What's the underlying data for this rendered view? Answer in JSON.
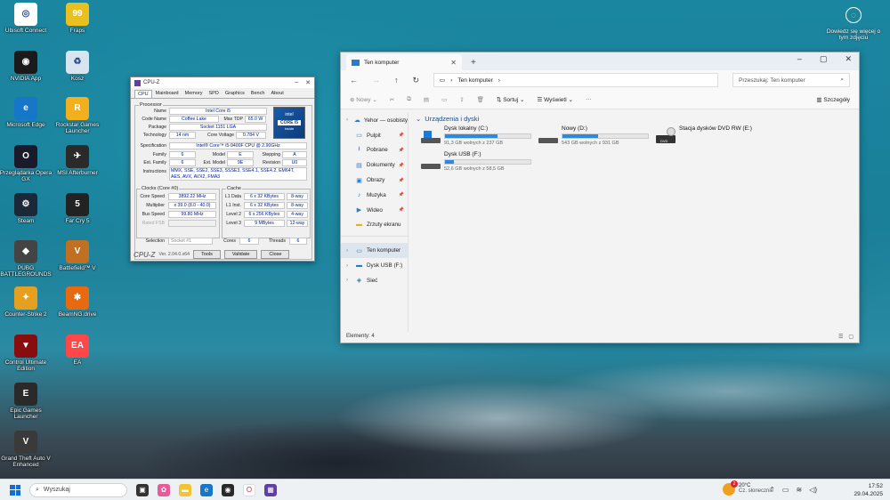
{
  "desktop": {
    "left_col": [
      {
        "label": "Ubisoft Connect",
        "icon": "ubisoft-icon",
        "color": "#ffffff",
        "glyph": "◎"
      },
      {
        "label": "NVIDIA App",
        "icon": "nvidia-icon",
        "color": "#1a1a1a",
        "glyph": "◉"
      },
      {
        "label": "Microsoft Edge",
        "icon": "edge-icon",
        "color": "#1677c8",
        "glyph": "e"
      },
      {
        "label": "Przeglądarka Opera GX",
        "icon": "opera-gx-icon",
        "color": "#1a1a2a",
        "glyph": "O"
      },
      {
        "label": "Steam",
        "icon": "steam-icon",
        "color": "#1b2838",
        "glyph": "⚙"
      },
      {
        "label": "PUBG BATTLEGROUNDS",
        "icon": "pubg-icon",
        "color": "#444444",
        "glyph": "◆"
      },
      {
        "label": "Counter-Strike 2",
        "icon": "cs2-icon",
        "color": "#e6a020",
        "glyph": "✦"
      },
      {
        "label": "Control Ultimate Edition",
        "icon": "control-icon",
        "color": "#8a0d0d",
        "glyph": "▼"
      },
      {
        "label": "Epic Games Launcher",
        "icon": "epic-games-icon",
        "color": "#2a2a2a",
        "glyph": "E"
      },
      {
        "label": "Grand Theft Auto V Enhanced",
        "icon": "gta5-icon",
        "color": "#3a3a3a",
        "glyph": "V"
      }
    ],
    "right_col": [
      {
        "label": "Fraps",
        "icon": "fraps-icon",
        "color": "#e8c020",
        "glyph": "99"
      },
      {
        "label": "Kosz",
        "icon": "recycle-bin-icon",
        "color": "#d8e4ee",
        "glyph": "♻"
      },
      {
        "label": "Rockstar Games Launcher",
        "icon": "rockstar-icon",
        "color": "#f2b01e",
        "glyph": "R"
      },
      {
        "label": "MSI Afterburner",
        "icon": "msi-afterburner-icon",
        "color": "#2a2a2a",
        "glyph": "✈"
      },
      {
        "label": "Far Cry 5",
        "icon": "farcry5-icon",
        "color": "#222222",
        "glyph": "5"
      },
      {
        "label": "Battlefield™ V",
        "icon": "battlefield-icon",
        "color": "#c07020",
        "glyph": "V"
      },
      {
        "label": "BeamNG.drive",
        "icon": "beamng-icon",
        "color": "#e86a10",
        "glyph": "✱"
      },
      {
        "label": "EA",
        "icon": "ea-icon",
        "color": "#ff4747",
        "glyph": "EA"
      }
    ],
    "learn_more": "Dowiedz się więcej o tym zdjęciu"
  },
  "cpuz": {
    "title": "CPU-Z",
    "tabs": [
      "CPU",
      "Mainboard",
      "Memory",
      "SPD",
      "Graphics",
      "Bench",
      "About"
    ],
    "processor_group": "Processor",
    "name_label": "Name",
    "name": "Intel Core i5",
    "codename_label": "Code Name",
    "codename": "Coffee Lake",
    "maxtdp_label": "Max TDP",
    "maxtdp": "65.0 W",
    "package_label": "Package",
    "package": "Socket 1151 LGA",
    "technology_label": "Technology",
    "technology": "14 nm",
    "corevoltage_label": "Core Voltage",
    "corevoltage": "0.784 V",
    "spec_label": "Specification",
    "spec": "Intel® Core™ i5-9400F CPU @ 2.90GHz",
    "family_label": "Family",
    "family": "6",
    "model_label": "Model",
    "model": "E",
    "stepping_label": "Stepping",
    "stepping": "A",
    "extfamily_label": "Ext. Family",
    "extfamily": "6",
    "extmodel_label": "Ext. Model",
    "extmodel": "9E",
    "revision_label": "Revision",
    "revision": "U0",
    "instructions_label": "Instructions",
    "instructions": "MMX, SSE, SSE2, SSE3, SSSE3, SSE4.1, SSE4.2, EM64T, AES, AVX, AVX2, FMA3",
    "clocks_group": "Clocks (Core #0)",
    "corespeed_label": "Core Speed",
    "corespeed": "3892.22 MHz",
    "multiplier_label": "Multiplier",
    "multiplier": "x 39.0 (8.0 - 40.0)",
    "busspeed_label": "Bus Speed",
    "busspeed": "99.80 MHz",
    "ratedfsb_label": "Rated FSB",
    "cache_group": "Cache",
    "l1data_label": "L1 Data",
    "l1data": "6 x 32 KBytes",
    "l1data_way": "8-way",
    "l1inst_label": "L1 Inst.",
    "l1inst": "6 x 32 KBytes",
    "l1inst_way": "8-way",
    "level2_label": "Level 2",
    "level2": "6 x 256 KBytes",
    "level2_way": "4-way",
    "level3_label": "Level 3",
    "level3": "9 MBytes",
    "level3_way": "12-way",
    "selection_label": "Selection",
    "selection": "Socket #1",
    "cores_label": "Cores",
    "cores": "6",
    "threads_label": "Threads",
    "threads": "6",
    "logo": "CPU-Z",
    "version": "Ver. 2.04.0.x64",
    "tools": "Tools",
    "validate": "Validate",
    "close": "Close",
    "intel_badge_top": "intel",
    "intel_badge_mid": "CORE i5",
    "intel_badge_bottom": "inside"
  },
  "explorer": {
    "tab_title": "Ten komputer",
    "address": "Ten komputer",
    "search_placeholder": "Przeszukaj: Ten komputer",
    "cmd_new": "Nowy",
    "cmd_sort": "Sortuj",
    "cmd_view": "Wyświetl",
    "cmd_more": "···",
    "cmd_details": "Szczegóły",
    "sidebar": [
      {
        "label": "Yehor — osobisty",
        "icon": "onedrive-icon",
        "glyph": "☁",
        "expand": true,
        "pin": false
      },
      {
        "label": "Pulpit",
        "icon": "desktop-folder-icon",
        "glyph": "▭",
        "expand": false,
        "pin": true
      },
      {
        "label": "Pobrane",
        "icon": "downloads-icon",
        "glyph": "⭳",
        "expand": false,
        "pin": true
      },
      {
        "label": "Dokumenty",
        "icon": "documents-icon",
        "glyph": "▤",
        "expand": false,
        "pin": true
      },
      {
        "label": "Obrazy",
        "icon": "pictures-icon",
        "glyph": "▣",
        "expand": false,
        "pin": true
      },
      {
        "label": "Muzyka",
        "icon": "music-icon",
        "glyph": "♪",
        "expand": false,
        "pin": true
      },
      {
        "label": "Wideo",
        "icon": "video-icon",
        "glyph": "▶",
        "expand": false,
        "pin": true
      },
      {
        "label": "Zrzuty ekranu",
        "icon": "folder-icon",
        "glyph": "▬",
        "expand": false,
        "pin": false
      },
      {
        "label": "",
        "icon": "",
        "glyph": "",
        "expand": false,
        "pin": false
      },
      {
        "label": "Ten komputer",
        "icon": "this-pc-icon",
        "glyph": "▭",
        "expand": true,
        "pin": false
      },
      {
        "label": "Dysk USB (F:)",
        "icon": "usb-drive-icon",
        "glyph": "▬",
        "expand": true,
        "pin": false
      },
      {
        "label": "Sieć",
        "icon": "network-icon",
        "glyph": "◈",
        "expand": true,
        "pin": false
      }
    ],
    "group_title": "Urządzenia i dyski",
    "drives": [
      {
        "name": "Dysk lokalny (C:)",
        "free": "91,3 GB wolnych z 237 GB",
        "used_fraction": 0.615,
        "windows": true
      },
      {
        "name": "Nowy (D:)",
        "free": "543 GB wolnych z 931 GB",
        "used_fraction": 0.417,
        "windows": false
      },
      {
        "name": "Dysk USB (F:)",
        "free": "52,6 GB wolnych z 58,5 GB",
        "used_fraction": 0.1,
        "windows": false
      }
    ],
    "dvd": "Stacja dysków DVD RW (E:)",
    "dvd_badge": "DVD",
    "status": "Elementy: 4"
  },
  "taskbar": {
    "search_placeholder": "Wyszukaj",
    "temp": "20°C",
    "weather": "Cz. słonecznie",
    "weather_badge": "2",
    "time": "17:52",
    "date": "29.04.2025"
  }
}
